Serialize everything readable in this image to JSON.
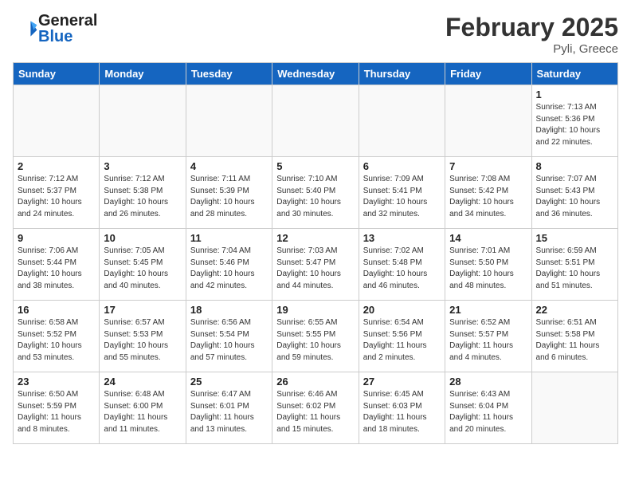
{
  "header": {
    "logo_general": "General",
    "logo_blue": "Blue",
    "month_year": "February 2025",
    "location": "Pyli, Greece"
  },
  "days_of_week": [
    "Sunday",
    "Monday",
    "Tuesday",
    "Wednesday",
    "Thursday",
    "Friday",
    "Saturday"
  ],
  "weeks": [
    {
      "days": [
        {
          "num": "",
          "info": ""
        },
        {
          "num": "",
          "info": ""
        },
        {
          "num": "",
          "info": ""
        },
        {
          "num": "",
          "info": ""
        },
        {
          "num": "",
          "info": ""
        },
        {
          "num": "",
          "info": ""
        },
        {
          "num": "1",
          "info": "Sunrise: 7:13 AM\nSunset: 5:36 PM\nDaylight: 10 hours\nand 22 minutes."
        }
      ]
    },
    {
      "days": [
        {
          "num": "2",
          "info": "Sunrise: 7:12 AM\nSunset: 5:37 PM\nDaylight: 10 hours\nand 24 minutes."
        },
        {
          "num": "3",
          "info": "Sunrise: 7:12 AM\nSunset: 5:38 PM\nDaylight: 10 hours\nand 26 minutes."
        },
        {
          "num": "4",
          "info": "Sunrise: 7:11 AM\nSunset: 5:39 PM\nDaylight: 10 hours\nand 28 minutes."
        },
        {
          "num": "5",
          "info": "Sunrise: 7:10 AM\nSunset: 5:40 PM\nDaylight: 10 hours\nand 30 minutes."
        },
        {
          "num": "6",
          "info": "Sunrise: 7:09 AM\nSunset: 5:41 PM\nDaylight: 10 hours\nand 32 minutes."
        },
        {
          "num": "7",
          "info": "Sunrise: 7:08 AM\nSunset: 5:42 PM\nDaylight: 10 hours\nand 34 minutes."
        },
        {
          "num": "8",
          "info": "Sunrise: 7:07 AM\nSunset: 5:43 PM\nDaylight: 10 hours\nand 36 minutes."
        }
      ]
    },
    {
      "days": [
        {
          "num": "9",
          "info": "Sunrise: 7:06 AM\nSunset: 5:44 PM\nDaylight: 10 hours\nand 38 minutes."
        },
        {
          "num": "10",
          "info": "Sunrise: 7:05 AM\nSunset: 5:45 PM\nDaylight: 10 hours\nand 40 minutes."
        },
        {
          "num": "11",
          "info": "Sunrise: 7:04 AM\nSunset: 5:46 PM\nDaylight: 10 hours\nand 42 minutes."
        },
        {
          "num": "12",
          "info": "Sunrise: 7:03 AM\nSunset: 5:47 PM\nDaylight: 10 hours\nand 44 minutes."
        },
        {
          "num": "13",
          "info": "Sunrise: 7:02 AM\nSunset: 5:48 PM\nDaylight: 10 hours\nand 46 minutes."
        },
        {
          "num": "14",
          "info": "Sunrise: 7:01 AM\nSunset: 5:50 PM\nDaylight: 10 hours\nand 48 minutes."
        },
        {
          "num": "15",
          "info": "Sunrise: 6:59 AM\nSunset: 5:51 PM\nDaylight: 10 hours\nand 51 minutes."
        }
      ]
    },
    {
      "days": [
        {
          "num": "16",
          "info": "Sunrise: 6:58 AM\nSunset: 5:52 PM\nDaylight: 10 hours\nand 53 minutes."
        },
        {
          "num": "17",
          "info": "Sunrise: 6:57 AM\nSunset: 5:53 PM\nDaylight: 10 hours\nand 55 minutes."
        },
        {
          "num": "18",
          "info": "Sunrise: 6:56 AM\nSunset: 5:54 PM\nDaylight: 10 hours\nand 57 minutes."
        },
        {
          "num": "19",
          "info": "Sunrise: 6:55 AM\nSunset: 5:55 PM\nDaylight: 10 hours\nand 59 minutes."
        },
        {
          "num": "20",
          "info": "Sunrise: 6:54 AM\nSunset: 5:56 PM\nDaylight: 11 hours\nand 2 minutes."
        },
        {
          "num": "21",
          "info": "Sunrise: 6:52 AM\nSunset: 5:57 PM\nDaylight: 11 hours\nand 4 minutes."
        },
        {
          "num": "22",
          "info": "Sunrise: 6:51 AM\nSunset: 5:58 PM\nDaylight: 11 hours\nand 6 minutes."
        }
      ]
    },
    {
      "days": [
        {
          "num": "23",
          "info": "Sunrise: 6:50 AM\nSunset: 5:59 PM\nDaylight: 11 hours\nand 8 minutes."
        },
        {
          "num": "24",
          "info": "Sunrise: 6:48 AM\nSunset: 6:00 PM\nDaylight: 11 hours\nand 11 minutes."
        },
        {
          "num": "25",
          "info": "Sunrise: 6:47 AM\nSunset: 6:01 PM\nDaylight: 11 hours\nand 13 minutes."
        },
        {
          "num": "26",
          "info": "Sunrise: 6:46 AM\nSunset: 6:02 PM\nDaylight: 11 hours\nand 15 minutes."
        },
        {
          "num": "27",
          "info": "Sunrise: 6:45 AM\nSunset: 6:03 PM\nDaylight: 11 hours\nand 18 minutes."
        },
        {
          "num": "28",
          "info": "Sunrise: 6:43 AM\nSunset: 6:04 PM\nDaylight: 11 hours\nand 20 minutes."
        },
        {
          "num": "",
          "info": ""
        }
      ]
    }
  ]
}
